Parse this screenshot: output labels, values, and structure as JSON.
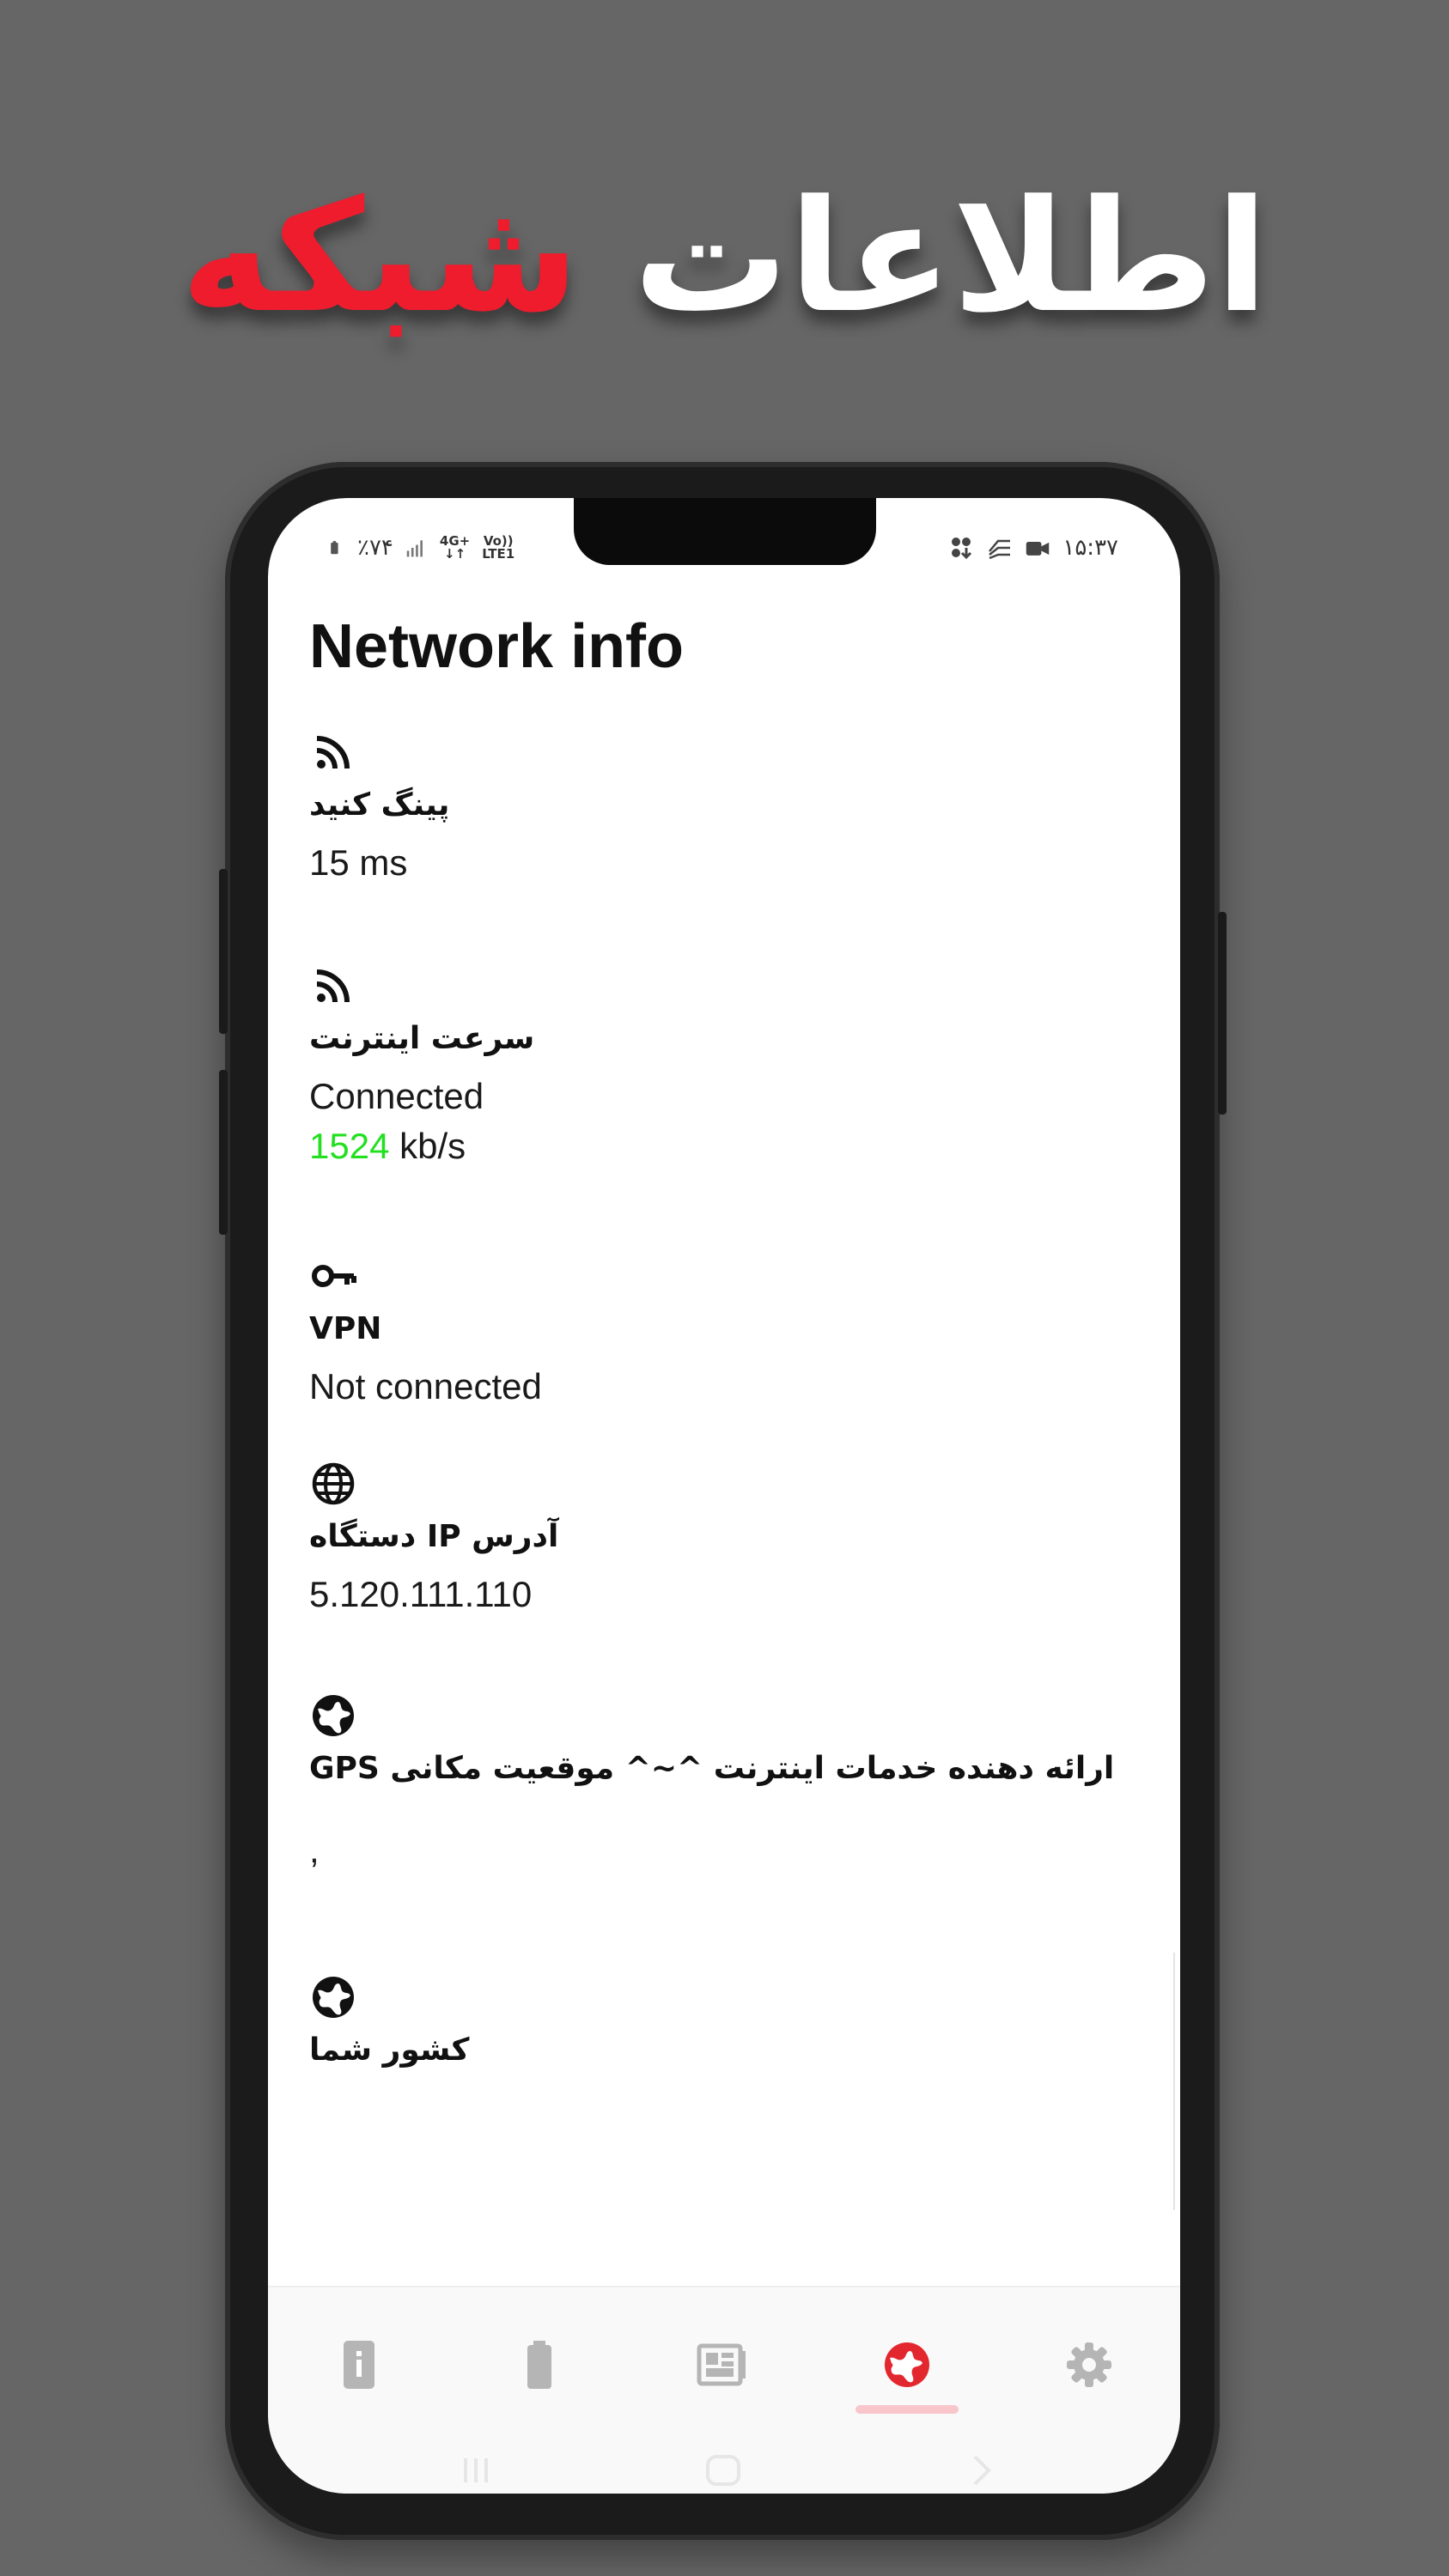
{
  "promo": {
    "headline_white": "اطلاعات",
    "headline_red": "شبکه",
    "colors": {
      "background": "#666666",
      "white": "#ffffff",
      "accent_red": "#ee1c2d"
    }
  },
  "status_bar": {
    "time": "۱۵:۳۷",
    "battery": "٪۷۴",
    "network_top": "4G+",
    "network_bottom": "LTE1",
    "volte_top": "Vo))",
    "volte_bottom": "LTE1",
    "icons_right": [
      "apps-download-icon",
      "notification-icon",
      "camera-icon"
    ],
    "icons_left": [
      "battery-icon",
      "signal-icon"
    ]
  },
  "page": {
    "title": "Network info",
    "items": [
      {
        "icon": "rss-icon",
        "label": "پینگ کنید",
        "value": "15 ms"
      },
      {
        "icon": "rss-icon",
        "label": "سرعت اینترنت",
        "status": "Connected",
        "speed_number": "1524",
        "speed_unit": " kb/s"
      },
      {
        "icon": "key-icon",
        "label": "VPN",
        "value": "Not connected"
      },
      {
        "icon": "globe-grid-icon",
        "label": "آدرس IP دستگاه",
        "value": "5.120.111.110"
      },
      {
        "icon": "earth-icon",
        "label": "ارائه دهنده خدمات اینترنت ^~^ موقعیت مکانی GPS",
        "value": ","
      },
      {
        "icon": "earth-icon",
        "label": "کشور شما",
        "value": ""
      }
    ],
    "colors": {
      "green": "#22e01f",
      "text": "#111111"
    }
  },
  "bottom_nav": {
    "tabs": [
      {
        "name": "info-icon",
        "active": false
      },
      {
        "name": "battery-icon",
        "active": false
      },
      {
        "name": "dashboard-icon",
        "active": false
      },
      {
        "name": "network-globe-icon",
        "active": true
      },
      {
        "name": "settings-gear-icon",
        "active": false
      }
    ],
    "active_color": "#e3272f",
    "inactive_color": "#b5b5b5"
  },
  "system_nav": [
    "recents-icon",
    "home-icon",
    "back-icon"
  ]
}
